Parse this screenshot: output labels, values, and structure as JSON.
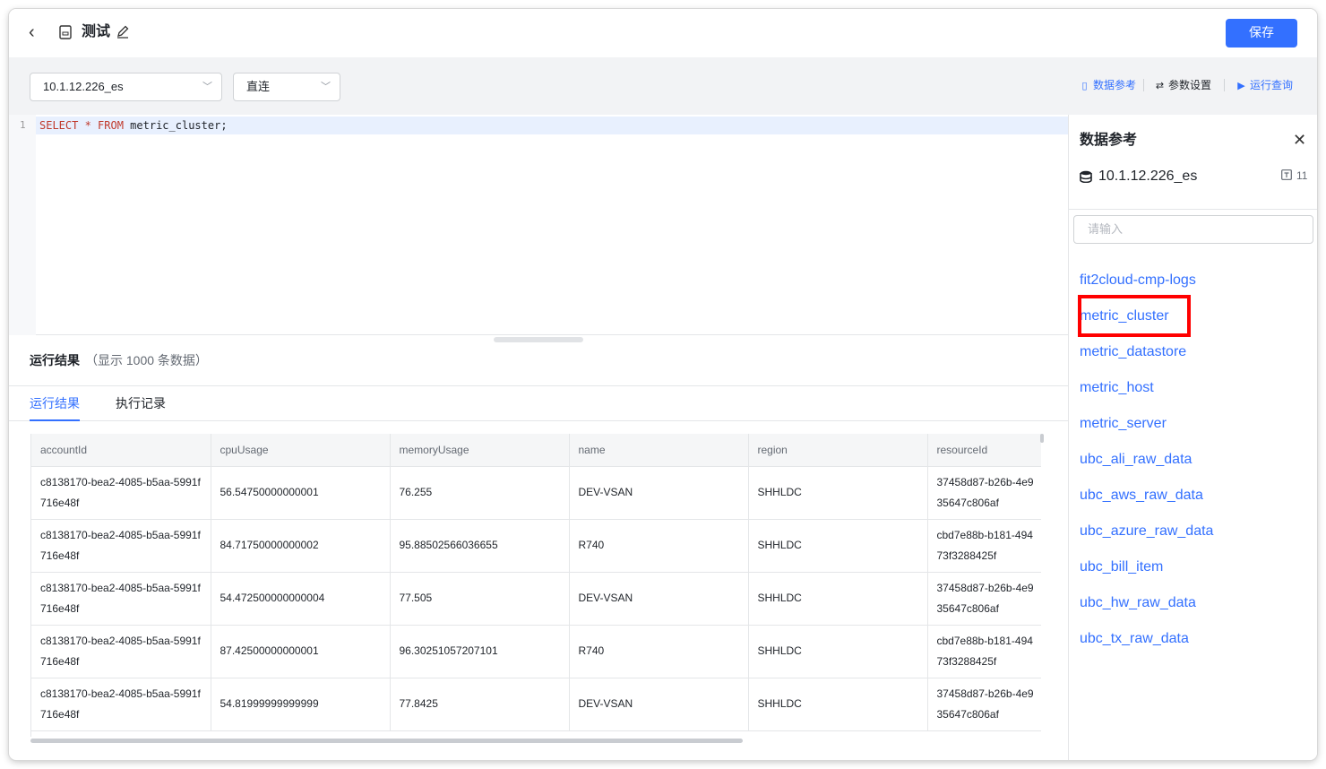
{
  "header": {
    "back_label": "‹",
    "title": "测试",
    "save_label": "保存"
  },
  "toolbar": {
    "datasource": "10.1.12.226_es",
    "connection_mode": "直连",
    "data_ref_label": "数据参考",
    "param_settings_label": "参数设置",
    "run_query_label": "运行查询"
  },
  "editor": {
    "line_number": "1",
    "sql_keyword_select": "SELECT",
    "sql_star": " * ",
    "sql_keyword_from": "FROM",
    "sql_rest": " metric_cluster;"
  },
  "results": {
    "title": "运行结果",
    "subtitle": "（显示 1000 条数据）",
    "tabs": [
      "运行结果",
      "执行记录"
    ],
    "columns": [
      "accountId",
      "cpuUsage",
      "memoryUsage",
      "name",
      "region",
      "resourceId"
    ],
    "rows": [
      [
        "c8138170-bea2-4085-b5aa-5991f716e48f",
        "56.54750000000001",
        "76.255",
        "DEV-VSAN",
        "SHHLDC",
        "37458d87-b26b-4e9",
        "35647c806af"
      ],
      [
        "c8138170-bea2-4085-b5aa-5991f716e48f",
        "84.71750000000002",
        "95.88502566036655",
        "R740",
        "SHHLDC",
        "cbd7e88b-b181-494",
        "73f3288425f"
      ],
      [
        "c8138170-bea2-4085-b5aa-5991f716e48f",
        "54.472500000000004",
        "77.505",
        "DEV-VSAN",
        "SHHLDC",
        "37458d87-b26b-4e9",
        "35647c806af"
      ],
      [
        "c8138170-bea2-4085-b5aa-5991f716e48f",
        "87.42500000000001",
        "96.30251057207101",
        "R740",
        "SHHLDC",
        "cbd7e88b-b181-494",
        "73f3288425f"
      ],
      [
        "c8138170-bea2-4085-b5aa-5991f716e48f",
        "54.81999999999999",
        "77.8425",
        "DEV-VSAN",
        "SHHLDC",
        "37458d87-b26b-4e9",
        "35647c806af"
      ]
    ]
  },
  "panel": {
    "title": "数据参考",
    "close_label": "✕",
    "db_name": "10.1.12.226_es",
    "table_count": "11",
    "search_placeholder": "请输入",
    "tables": [
      "fit2cloud-cmp-logs",
      "metric_cluster",
      "metric_datastore",
      "metric_host",
      "metric_server",
      "ubc_ali_raw_data",
      "ubc_aws_raw_data",
      "ubc_azure_raw_data",
      "ubc_bill_item",
      "ubc_hw_raw_data",
      "ubc_tx_raw_data"
    ],
    "highlighted_table": "metric_cluster"
  },
  "colors": {
    "accent": "#3370ff",
    "highlight": "#ff0000",
    "keyword": "#c0392b"
  }
}
